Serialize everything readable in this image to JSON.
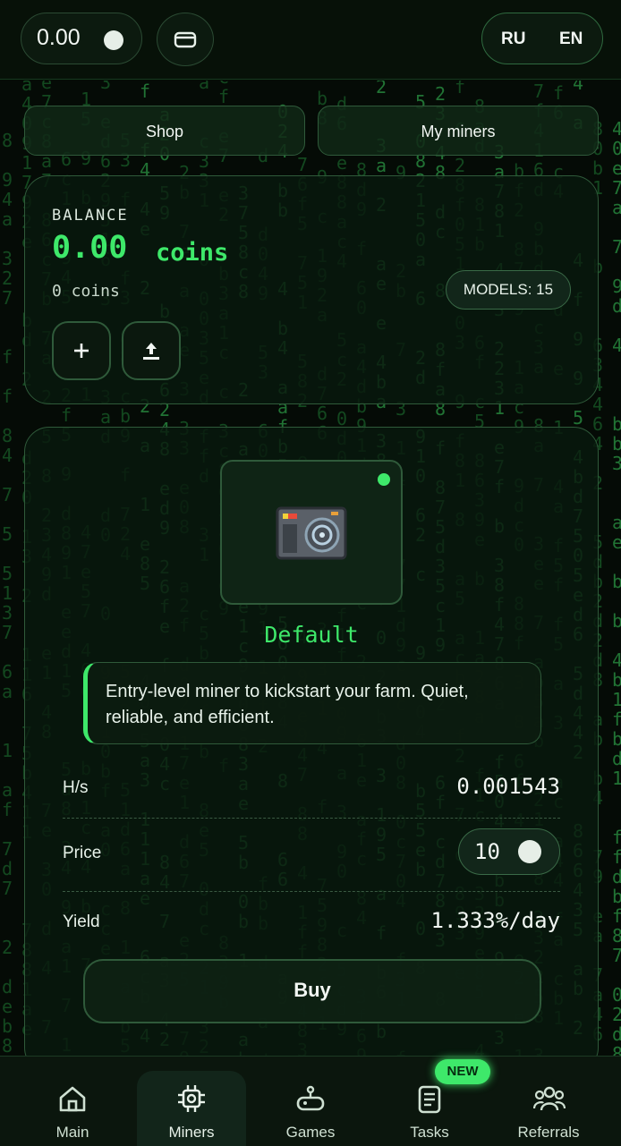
{
  "header": {
    "balance": "0.00",
    "lang_ru": "RU",
    "lang_en": "EN"
  },
  "tabs": {
    "shop": "Shop",
    "my_miners": "My miners"
  },
  "balance_card": {
    "label": "BALANCE",
    "amount": "0.00",
    "unit": "coins",
    "sub": "0 coins",
    "models_badge": "MODELS: 15"
  },
  "miner": {
    "name": "Default",
    "description": "Entry-level miner to kickstart your farm. Quiet, reliable, and efficient.",
    "hs_label": "H/s",
    "hs_value": "0.001543",
    "price_label": "Price",
    "price_value": "10",
    "yield_label": "Yield",
    "yield_value": "1.333%/day",
    "buy_label": "Buy"
  },
  "nav": {
    "main": "Main",
    "miners": "Miners",
    "games": "Games",
    "tasks": "Tasks",
    "referrals": "Referrals",
    "new_badge": "NEW"
  },
  "colors": {
    "accent": "#3ee86a",
    "background": "#050b06",
    "border": "#2f5a3a"
  }
}
